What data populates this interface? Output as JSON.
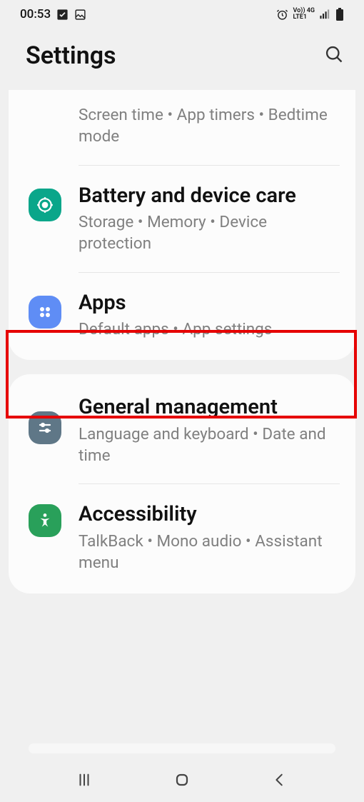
{
  "statusbar": {
    "time": "00:53",
    "network_label": "Vo)) 4G",
    "network_sub": "LTE1"
  },
  "header": {
    "title": "Settings"
  },
  "card1": {
    "digital_wellbeing_sub": "Screen time  •  App timers  •  Bedtime mode",
    "battery_title": "Battery and device care",
    "battery_sub": "Storage  •  Memory  •  Device protection",
    "apps_title": "Apps",
    "apps_sub": "Default apps  •  App settings"
  },
  "card2": {
    "general_title": "General management",
    "general_sub": "Language and keyboard  •  Date and time",
    "a11y_title": "Accessibility",
    "a11y_sub": "TalkBack  •  Mono audio  •  Assistant menu"
  }
}
